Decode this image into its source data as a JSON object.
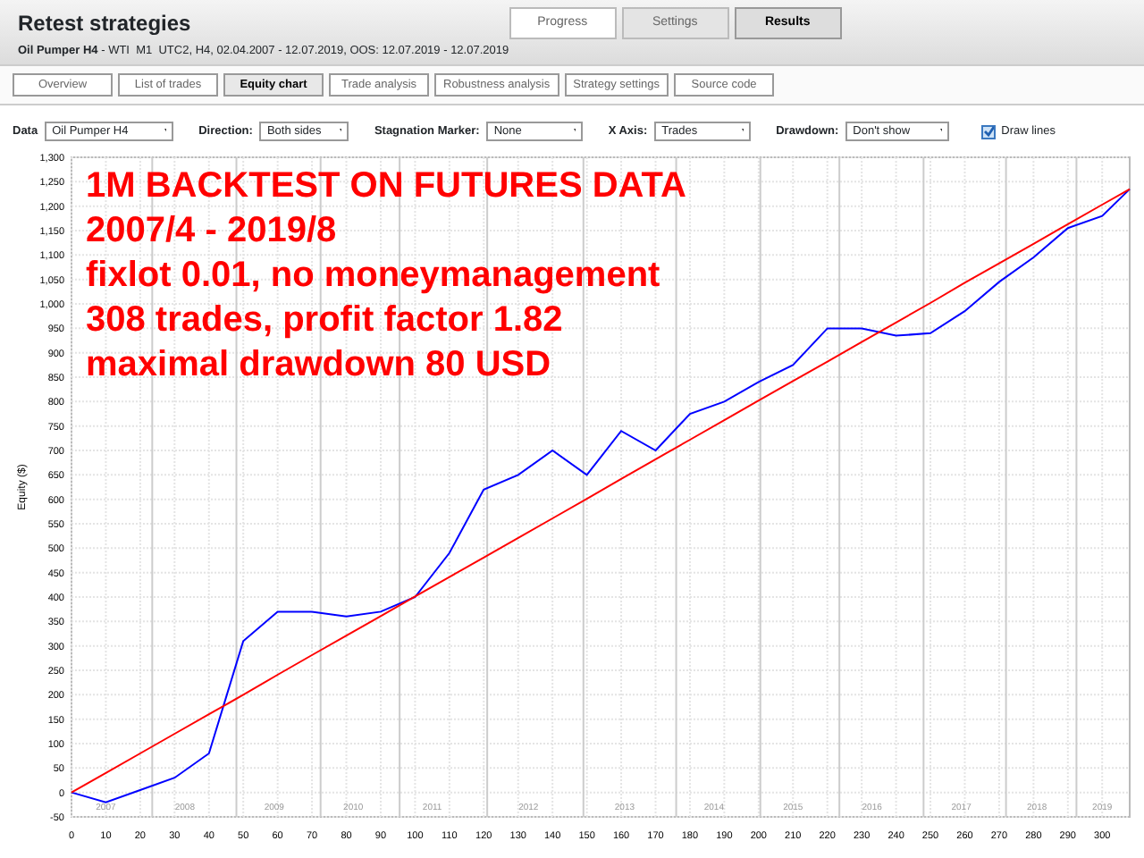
{
  "header": {
    "title": "Retest strategies",
    "subtitle": "**Oil Pumper H4** - WTI  M1  UTC2, H4, 02.04.2007 - 12.07.2019, OOS: 12.07.2019 - 12.07.2019"
  },
  "mode_buttons": [
    {
      "label": "Progress",
      "selected": false
    },
    {
      "label": "Settings",
      "selected": false
    },
    {
      "label": "Results",
      "selected": true
    }
  ],
  "tabs": [
    {
      "label": "Overview",
      "selected": false
    },
    {
      "label": "List of trades",
      "selected": false
    },
    {
      "label": "Equity chart",
      "selected": true
    },
    {
      "label": "Trade analysis",
      "selected": false
    },
    {
      "label": "Robustness analysis",
      "selected": false
    },
    {
      "label": "Strategy settings",
      "selected": false
    },
    {
      "label": "Source code",
      "selected": false
    }
  ],
  "controls": [
    {
      "kind": "select",
      "label": "Data",
      "value": "Oil Pumper H4"
    },
    {
      "kind": "select",
      "label": "Direction:",
      "value": "Both sides"
    },
    {
      "kind": "select",
      "label": "Stagnation Marker:",
      "value": "None"
    },
    {
      "kind": "select",
      "label": "X Axis:",
      "value": "Trades"
    },
    {
      "kind": "select",
      "label": "Drawdown:",
      "value": "Don't show"
    },
    {
      "kind": "checkbox",
      "label": "Draw lines",
      "checked": true
    }
  ],
  "overlay_text": [
    "1M BACKTEST ON FUTURES DATA",
    "2007/4 - 2019/8",
    "fixlot 0.01, no moneymanagement",
    "308 trades, profit factor 1.82",
    "maximal drawdown 80 USD"
  ],
  "chart_data": {
    "type": "line",
    "ylabel": "Equity ($)",
    "x": [
      0,
      10,
      20,
      30,
      40,
      50,
      60,
      70,
      80,
      90,
      100,
      110,
      120,
      130,
      140,
      150,
      160,
      170,
      180,
      190,
      200,
      210,
      220,
      230,
      240,
      250,
      260,
      270,
      280,
      290,
      300,
      308
    ],
    "series": [
      {
        "color": "#0000ff",
        "values": [
          0,
          -20,
          5,
          30,
          80,
          310,
          370,
          370,
          360,
          370,
          400,
          490,
          620,
          650,
          700,
          650,
          740,
          700,
          775,
          800,
          840,
          875,
          950,
          950,
          935,
          940,
          985,
          1045,
          1095,
          1155,
          1180,
          1235
        ]
      },
      {
        "color": "#ff0000",
        "values": [
          0,
          40,
          80,
          120,
          160,
          200,
          241,
          281,
          321,
          361,
          401,
          441,
          481,
          521,
          561,
          601,
          642,
          682,
          722,
          762,
          802,
          842,
          882,
          922,
          962,
          1002,
          1043,
          1083,
          1123,
          1163,
          1203,
          1235
        ]
      }
    ],
    "grid": true,
    "xlim": [
      0,
      308
    ],
    "ylim": [
      -50,
      1300
    ],
    "xticks": [
      0,
      10,
      20,
      30,
      40,
      50,
      60,
      70,
      80,
      90,
      100,
      110,
      120,
      130,
      140,
      150,
      160,
      170,
      180,
      190,
      200,
      210,
      220,
      230,
      240,
      250,
      260,
      270,
      280,
      290,
      300
    ],
    "yticks": [
      -50,
      0,
      50,
      100,
      150,
      200,
      250,
      300,
      350,
      400,
      450,
      500,
      550,
      600,
      650,
      700,
      750,
      800,
      850,
      900,
      950,
      {
        "value": 1000,
        "label": "1,000"
      },
      {
        "value": 1050,
        "label": "1,050"
      },
      {
        "value": 1100,
        "label": "1,100"
      },
      {
        "value": 1150,
        "label": "1,150"
      },
      {
        "value": 1200,
        "label": "1,200"
      },
      {
        "value": 1250,
        "label": "1,250"
      },
      {
        "value": 1300,
        "label": "1,300"
      }
    ],
    "annotations": [
      "2007",
      "2008",
      "2009",
      "2010",
      "2011",
      "2012",
      "2013",
      "2014",
      "2015",
      "2016",
      "2017",
      "2018",
      "2019"
    ]
  }
}
